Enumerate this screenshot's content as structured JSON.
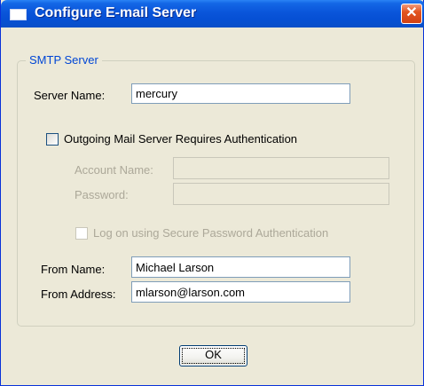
{
  "window": {
    "title": "Configure E-mail Server",
    "close_glyph": "✕"
  },
  "group": {
    "title": "SMTP Server"
  },
  "server": {
    "label": "Server Name:",
    "value": "mercury"
  },
  "auth": {
    "label": "Outgoing Mail Server Requires Authentication",
    "checked": false
  },
  "account": {
    "label": "Account Name:",
    "value": ""
  },
  "password": {
    "label": "Password:",
    "value": ""
  },
  "spa": {
    "label": "Log on using Secure Password Authentication",
    "checked": false
  },
  "from_name": {
    "label": "From Name:",
    "value": "Michael Larson"
  },
  "from_address": {
    "label": "From Address:",
    "value": "mlarson@larson.com"
  },
  "ok_button": {
    "label": "OK"
  }
}
